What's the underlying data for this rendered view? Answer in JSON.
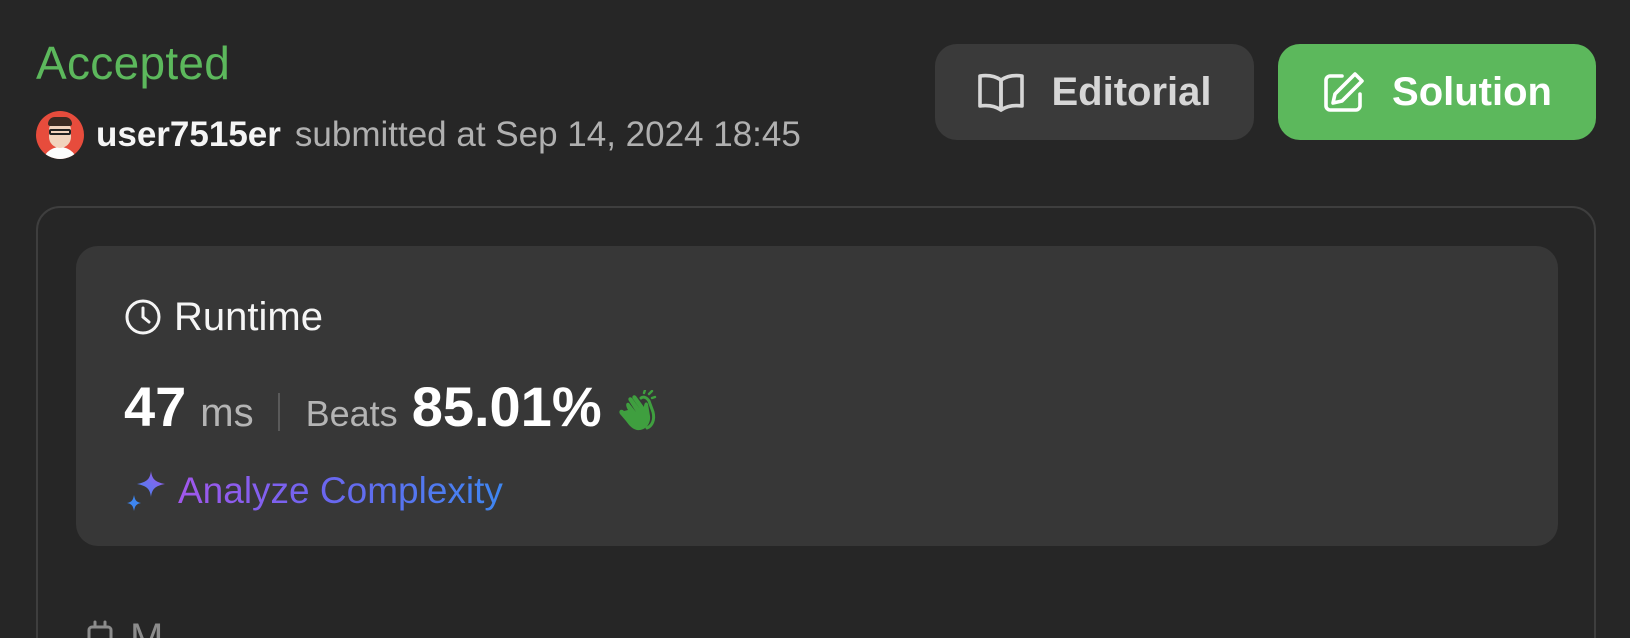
{
  "submission": {
    "status": "Accepted",
    "username": "user7515er",
    "submitted_text": "submitted at Sep 14, 2024 18:45"
  },
  "buttons": {
    "editorial_label": "Editorial",
    "solution_label": "Solution"
  },
  "runtime": {
    "title": "Runtime",
    "value": "47",
    "unit": "ms",
    "beats_label": "Beats",
    "beats_value": "85.01%",
    "analyze_label": "Analyze Complexity"
  },
  "memory": {
    "title_partial": "M"
  },
  "icons": {
    "editorial": "book-open-icon",
    "solution": "edit-pencil-icon",
    "runtime": "clock-icon",
    "beats": "clapping-hands-icon",
    "analyze": "sparkles-icon",
    "memory": "memory-chip-icon"
  },
  "colors": {
    "accepted": "#5cb85c",
    "solution_button": "#5cb85c",
    "background": "#262626",
    "card": "#373737"
  }
}
